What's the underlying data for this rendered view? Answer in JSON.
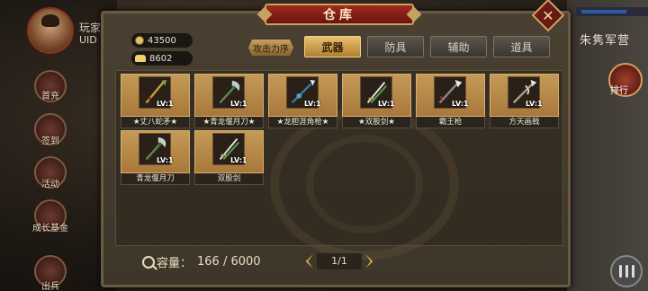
{
  "player": {
    "name": "玩家",
    "uid_label": "UID"
  },
  "side_menu": [
    {
      "label": "首充"
    },
    {
      "label": "签到"
    },
    {
      "label": "活动"
    },
    {
      "label": "成长基金"
    },
    {
      "label": "出兵"
    }
  ],
  "right": {
    "title": "朱隽军营",
    "rank_label": "排行"
  },
  "warehouse": {
    "title": "仓库",
    "close_label": "✕",
    "currencies": [
      {
        "icon": "coin-icon",
        "value": "43500"
      },
      {
        "icon": "ingot-icon",
        "value": "8602"
      }
    ],
    "sort_label": "攻击力序",
    "tabs": [
      {
        "label": "武器",
        "active": true
      },
      {
        "label": "防具",
        "active": false
      },
      {
        "label": "辅助",
        "active": false
      },
      {
        "label": "道具",
        "active": false
      }
    ],
    "items": [
      {
        "name": "★丈八蛇矛★",
        "level": "LV:1",
        "icon": "serpent-spear-icon"
      },
      {
        "name": "★青龙偃月刀★",
        "level": "LV:1",
        "icon": "crescent-blade-icon"
      },
      {
        "name": "★龙胆涯角枪★",
        "level": "LV:1",
        "icon": "dragon-spear-icon"
      },
      {
        "name": "★双股剑★",
        "level": "LV:1",
        "icon": "twin-swords-icon"
      },
      {
        "name": "霸王枪",
        "level": "LV:1",
        "icon": "overlord-spear-icon"
      },
      {
        "name": "方天画戟",
        "level": "LV:1",
        "icon": "halberd-icon"
      },
      {
        "name": "青龙偃月刀",
        "level": "LV:1",
        "icon": "crescent-blade-icon"
      },
      {
        "name": "双股剑",
        "level": "LV:1",
        "icon": "twin-swords-icon"
      }
    ],
    "capacity_label": "容量：",
    "capacity_value": "166 / 6000",
    "page": "1/1"
  }
}
